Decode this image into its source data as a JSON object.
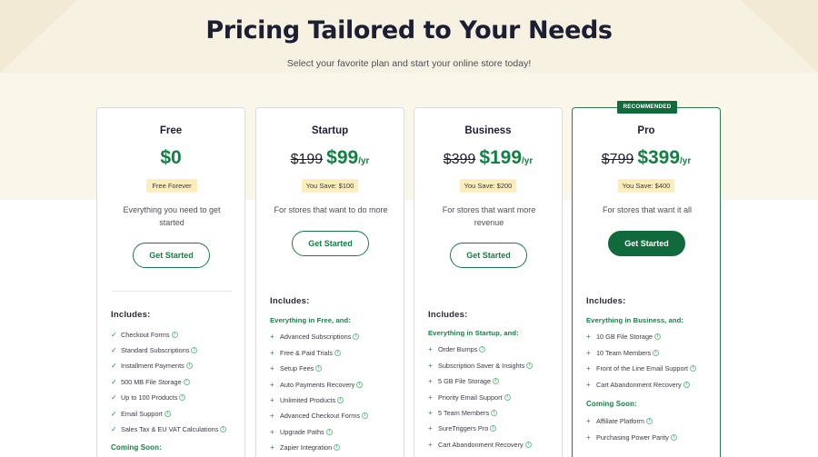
{
  "header": {
    "title": "Pricing Tailored to Your Needs",
    "subtitle": "Select your favorite plan and start your online store today!"
  },
  "plans": [
    {
      "name": "Free",
      "price": "$0",
      "save": "Free Forever",
      "description": "Everything you need to get started",
      "button": "Get Started",
      "includes": "Includes:",
      "features": [
        "Checkout Forms",
        "Standard Subscriptions",
        "Installment Payments",
        "500 MB File Storage",
        "Up to 100 Products",
        "Email Support",
        "Sales Tax & EU VAT Calculations"
      ],
      "coming_soon": "Coming Soon:"
    },
    {
      "name": "Startup",
      "old_price": "$199",
      "price": "$99",
      "unit": "/yr",
      "save": "You Save: $100",
      "description": "For stores that want to do more",
      "button": "Get Started",
      "includes": "Includes:",
      "group": "Everything in Free, and:",
      "features": [
        "Advanced Subscriptions",
        "Free & Paid Trials",
        "Setup Fees",
        "Auto Payments Recovery",
        "Unlimited Products",
        "Advanced Checkout Forms",
        "Upgrade Paths",
        "Zapier Integration"
      ]
    },
    {
      "name": "Business",
      "old_price": "$399",
      "price": "$199",
      "unit": "/yr",
      "save": "You Save: $200",
      "description": "For stores that want more revenue",
      "button": "Get Started",
      "includes": "Includes:",
      "group": "Everything in Startup, and:",
      "features": [
        "Order Bumps",
        "Subscription Saver & Insights",
        "5 GB File Storage",
        "Priority Email Support",
        "5 Team Members",
        "SureTriggers Pro",
        "Cart Abandonment Recovery"
      ]
    },
    {
      "name": "Pro",
      "badge": "RECOMMENDED",
      "old_price": "$799",
      "price": "$399",
      "unit": "/yr",
      "save": "You Save: $400",
      "description": "For stores that want it all",
      "button": "Get Started",
      "includes": "Includes:",
      "group": "Everything in Business, and:",
      "features": [
        "10 GB File Storage",
        "10 Team Members",
        "Front of the Line Email Support",
        "Cart Abandonment Recovery"
      ],
      "coming_soon": "Coming Soon:",
      "coming_features": [
        "Affiliate Platform",
        "Purchasing Power Parity"
      ]
    }
  ],
  "colors": {
    "accent": "#138043",
    "button_fill": "#0f6b3c",
    "save_badge": "#fcedbb",
    "hero_bg": "#faf6ea"
  },
  "icons": {
    "free_feature": "check-icon",
    "paid_feature": "plus-icon",
    "info": "info-icon"
  }
}
